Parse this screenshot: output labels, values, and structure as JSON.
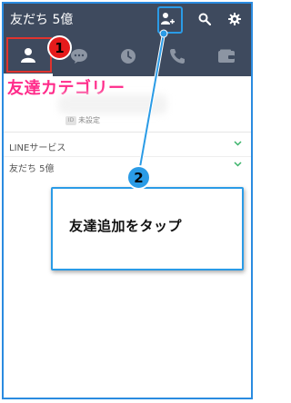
{
  "header": {
    "title": "友だち 5億",
    "icons": [
      "add-friend-icon",
      "search-icon",
      "gear-icon"
    ]
  },
  "tabs": [
    {
      "name": "friends",
      "icon": "person-icon",
      "active": true
    },
    {
      "name": "chats",
      "icon": "chat-bubble-icon",
      "active": false
    },
    {
      "name": "timeline",
      "icon": "clock-icon",
      "active": false
    },
    {
      "name": "calls",
      "icon": "phone-icon",
      "active": false
    },
    {
      "name": "wallet",
      "icon": "wallet-icon",
      "active": false
    }
  ],
  "annotations": {
    "badge_1": "1",
    "badge_2": "2",
    "category_label": "友達カテゴリー",
    "callout_text": "友達追加をタップ"
  },
  "profile": {
    "status_text": "未設定",
    "id_label": "ID"
  },
  "rows": [
    {
      "label": "LINEサービス"
    },
    {
      "label": "友だち 5億"
    }
  ],
  "colors": {
    "header_bg": "#3e4a5e",
    "highlight_red": "#e0332e",
    "highlight_blue": "#2a9be6",
    "category_pink": "#ff2b8a",
    "chevron_green": "#3bb36a"
  }
}
